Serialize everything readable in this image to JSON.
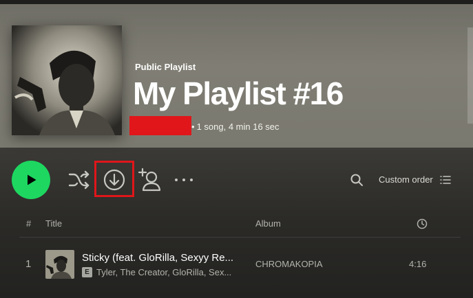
{
  "header": {
    "type_label": "Public Playlist",
    "title": "My Playlist #16",
    "meta": "1 song, 4 min 16 sec",
    "meta_separator": "•"
  },
  "controls": {
    "play_icon": "play-icon",
    "shuffle_icon": "shuffle-icon",
    "download_icon": "download-icon",
    "invite_icon": "add-user-icon",
    "more_icon": "more-options-icon",
    "search_icon": "search-icon",
    "order_label": "Custom order",
    "order_icon": "list-icon"
  },
  "table": {
    "headers": {
      "num": "#",
      "title": "Title",
      "album": "Album",
      "duration_icon": "clock-icon"
    },
    "rows": [
      {
        "num": "1",
        "title": "Sticky (feat. GloRilla, Sexyy Re...",
        "explicit": "E",
        "artists": "Tyler, The Creator, GloRilla, Sex...",
        "album": "CHROMAKOPIA",
        "duration": "4:16"
      }
    ]
  },
  "colors": {
    "accent": "#1ed760",
    "highlight_frame": "#e0161a",
    "redaction": "#e0161a"
  }
}
